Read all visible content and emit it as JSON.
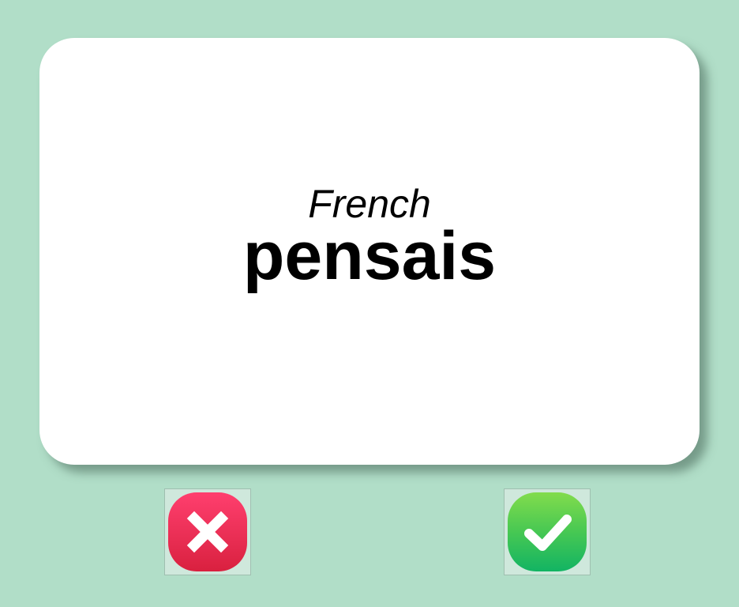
{
  "card": {
    "language": "French",
    "word": "pensais"
  },
  "buttons": {
    "wrong": {
      "icon": "x-mark-icon",
      "color": "#ea2f55"
    },
    "right": {
      "icon": "check-mark-icon",
      "color": "#3cc15a"
    }
  },
  "colors": {
    "background": "#b1dec8",
    "card": "#ffffff"
  }
}
